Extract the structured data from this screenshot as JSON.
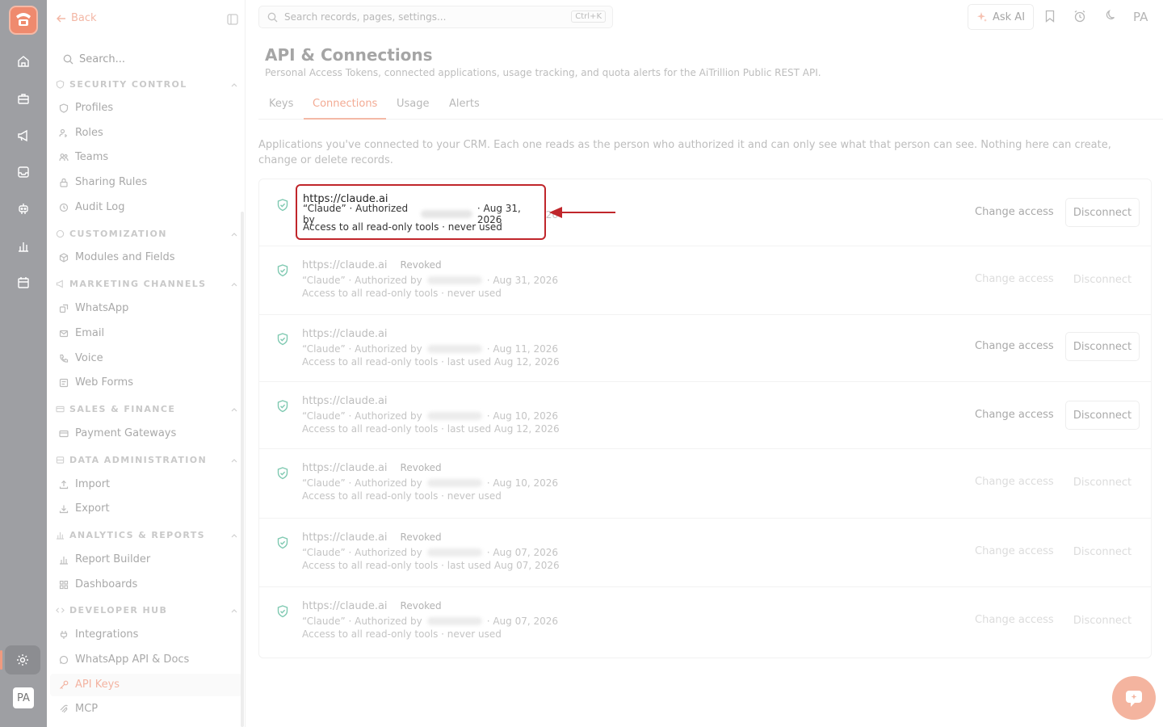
{
  "sidebar": {
    "back_label": "Back",
    "search_placeholder": "Search...",
    "sections": [
      {
        "label": "SECURITY CONTROL",
        "items": [
          "Profiles",
          "Roles",
          "Teams",
          "Sharing Rules",
          "Audit Log"
        ]
      },
      {
        "label": "CUSTOMIZATION",
        "items": [
          "Modules and Fields"
        ]
      },
      {
        "label": "MARKETING CHANNELS",
        "items": [
          "WhatsApp",
          "Email",
          "Voice",
          "Web Forms"
        ]
      },
      {
        "label": "SALES & FINANCE",
        "items": [
          "Payment Gateways"
        ]
      },
      {
        "label": "DATA ADMINISTRATION",
        "items": [
          "Import",
          "Export"
        ]
      },
      {
        "label": "ANALYTICS & REPORTS",
        "items": [
          "Report Builder",
          "Dashboards"
        ]
      },
      {
        "label": "DEVELOPER HUB",
        "items": [
          "Integrations",
          "WhatsApp API & Docs",
          "API Keys",
          "MCP"
        ]
      }
    ],
    "active_item": "API Keys"
  },
  "rail": {
    "avatar": "PA"
  },
  "topbar": {
    "search_placeholder": "Search records, pages, settings...",
    "shortcut": "Ctrl+K",
    "ask_ai": "Ask AI",
    "user_initials": "PA"
  },
  "page": {
    "title": "API & Connections",
    "subtitle": "Personal Access Tokens, connected applications, usage tracking, and quota alerts for the AiTrillion Public REST API.",
    "tabs": [
      "Keys",
      "Connections",
      "Usage",
      "Alerts"
    ],
    "active_tab": "Connections",
    "intro": "Applications you've connected to your CRM. Each one reads as the person who authorized it and can only see what that person can see. Nothing here can create, change or delete records."
  },
  "actions": {
    "change_access": "Change access",
    "disconnect": "Disconnect"
  },
  "connections": [
    {
      "url": "https://claude.ai",
      "badge": "",
      "name_prefix": "“Claude” · Authorized by",
      "date": "· Aug 31, 2026",
      "scope": "Access to all read-only tools · never used",
      "revoked": false
    },
    {
      "url": "https://claude.ai",
      "badge": "Revoked",
      "name_prefix": "“Claude” · Authorized by",
      "date": "· Aug 31, 2026",
      "scope": "Access to all read-only tools · never used",
      "revoked": true
    },
    {
      "url": "https://claude.ai",
      "badge": "",
      "name_prefix": "“Claude” · Authorized by",
      "date": "· Aug 11, 2026",
      "scope": "Access to all read-only tools · last used Aug 12, 2026",
      "revoked": false
    },
    {
      "url": "https://claude.ai",
      "badge": "",
      "name_prefix": "“Claude” · Authorized by",
      "date": "· Aug 10, 2026",
      "scope": "Access to all read-only tools · last used Aug 12, 2026",
      "revoked": false
    },
    {
      "url": "https://claude.ai",
      "badge": "Revoked",
      "name_prefix": "“Claude” · Authorized by",
      "date": "· Aug 10, 2026",
      "scope": "Access to all read-only tools · never used",
      "revoked": true
    },
    {
      "url": "https://claude.ai",
      "badge": "Revoked",
      "name_prefix": "“Claude” · Authorized by",
      "date": "· Aug 07, 2026",
      "scope": "Access to all read-only tools · last used Aug 07, 2026",
      "revoked": true
    },
    {
      "url": "https://claude.ai",
      "badge": "Revoked",
      "name_prefix": "“Claude” · Authorized by",
      "date": "· Aug 07, 2026",
      "scope": "Access to all read-only tools · never used",
      "revoked": true
    }
  ],
  "colors": {
    "accent": "#f3ab94",
    "highlight_border": "#c0262b",
    "rail": "#9e9fa3"
  }
}
